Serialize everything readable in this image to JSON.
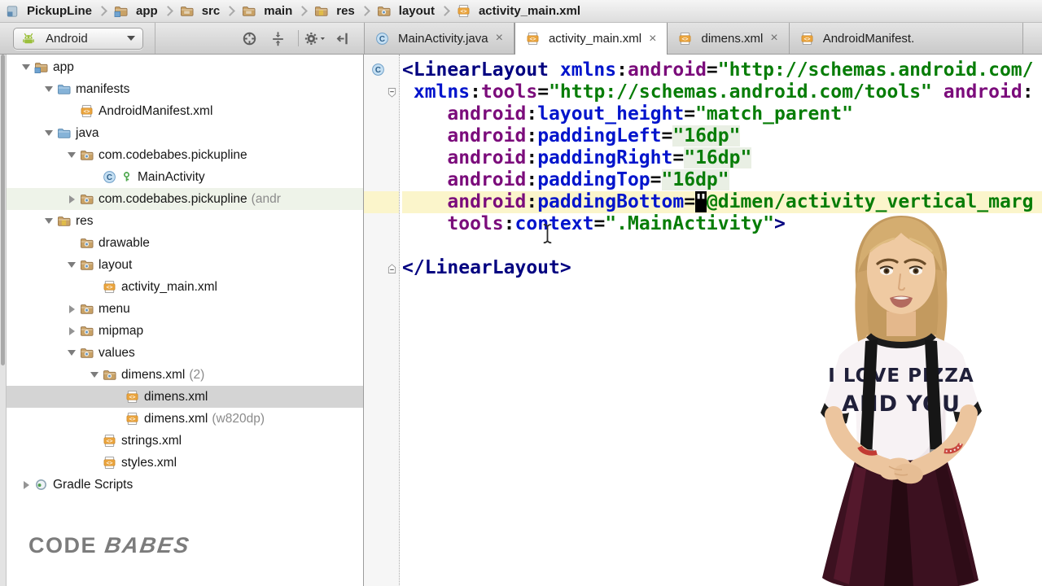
{
  "breadcrumb": {
    "items": [
      {
        "label": "PickupLine",
        "icon": "project-icon"
      },
      {
        "label": "app",
        "icon": "module-folder-icon"
      },
      {
        "label": "src",
        "icon": "folder-icon"
      },
      {
        "label": "main",
        "icon": "folder-icon"
      },
      {
        "label": "res",
        "icon": "res-folder-icon"
      },
      {
        "label": "layout",
        "icon": "package-folder-icon"
      },
      {
        "label": "activity_main.xml",
        "icon": "xml-file-icon"
      }
    ]
  },
  "project_panel": {
    "view_selector": {
      "label": "Android",
      "icon": "android-icon"
    },
    "toolbar_icons": [
      "locate-icon",
      "collapse-all-icon",
      "|",
      "settings-gear-icon",
      "hide-panel-icon"
    ],
    "tree": [
      {
        "label": "app",
        "icons": [
          "module-folder-icon"
        ],
        "indent": 0,
        "arrow": "down"
      },
      {
        "label": "manifests",
        "icons": [
          "folder-blue-icon"
        ],
        "indent": 1,
        "arrow": "down"
      },
      {
        "label": "AndroidManifest.xml",
        "icons": [
          "xml-file-icon"
        ],
        "indent": 2,
        "arrow": ""
      },
      {
        "label": "java",
        "icons": [
          "folder-blue-icon"
        ],
        "indent": 1,
        "arrow": "down"
      },
      {
        "label": "com.codebabes.pickupline",
        "icons": [
          "package-folder-icon"
        ],
        "indent": 2,
        "arrow": "down"
      },
      {
        "label": "MainActivity",
        "icons": [
          "class-icon",
          "key-icon"
        ],
        "indent": 3,
        "arrow": ""
      },
      {
        "label": "com.codebabes.pickupline",
        "suffix": " (andr",
        "icons": [
          "package-folder-icon"
        ],
        "indent": 2,
        "arrow": "right",
        "hover": true
      },
      {
        "label": "res",
        "icons": [
          "res-folder-icon"
        ],
        "indent": 1,
        "arrow": "down"
      },
      {
        "label": "drawable",
        "icons": [
          "package-folder-icon"
        ],
        "indent": 2,
        "arrow": ""
      },
      {
        "label": "layout",
        "icons": [
          "package-folder-icon"
        ],
        "indent": 2,
        "arrow": "down"
      },
      {
        "label": "activity_main.xml",
        "icons": [
          "xml-file-icon"
        ],
        "indent": 3,
        "arrow": ""
      },
      {
        "label": "menu",
        "icons": [
          "package-folder-icon"
        ],
        "indent": 2,
        "arrow": "right"
      },
      {
        "label": "mipmap",
        "icons": [
          "package-folder-icon"
        ],
        "indent": 2,
        "arrow": "right"
      },
      {
        "label": "values",
        "icons": [
          "package-folder-icon"
        ],
        "indent": 2,
        "arrow": "down"
      },
      {
        "label": "dimens.xml",
        "suffix": " (2)",
        "icons": [
          "package-folder-icon"
        ],
        "indent": 3,
        "arrow": "down"
      },
      {
        "label": "dimens.xml",
        "icons": [
          "xml-file-icon"
        ],
        "indent": 4,
        "arrow": "",
        "selected": true
      },
      {
        "label": "dimens.xml",
        "suffix": " (w820dp)",
        "icons": [
          "xml-file-icon"
        ],
        "indent": 4,
        "arrow": ""
      },
      {
        "label": "strings.xml",
        "icons": [
          "xml-file-icon"
        ],
        "indent": 3,
        "arrow": ""
      },
      {
        "label": "styles.xml",
        "icons": [
          "xml-file-icon"
        ],
        "indent": 3,
        "arrow": ""
      },
      {
        "label": "Gradle Scripts",
        "icons": [
          "gradle-icon"
        ],
        "indent": 0,
        "arrow": "right"
      }
    ]
  },
  "tabs": {
    "items": [
      {
        "label": "MainActivity.java",
        "icon": "class-icon",
        "close": true,
        "active": false
      },
      {
        "label": "activity_main.xml",
        "icon": "xml-file-icon",
        "close": true,
        "active": true
      },
      {
        "label": "dimens.xml",
        "icon": "xml-file-icon",
        "close": true,
        "active": false
      },
      {
        "label": "AndroidManifest.",
        "icon": "xml-file-icon",
        "close": false,
        "active": false
      }
    ],
    "close_glyph": "×"
  },
  "editor": {
    "lines": [
      {
        "gutter": "class-icon",
        "tokens": [
          [
            "tag",
            "<LinearLayout"
          ],
          [
            "pl",
            " "
          ],
          [
            "attr",
            "xmlns"
          ],
          [
            "pl",
            ":"
          ],
          [
            "ns",
            "android"
          ],
          [
            "pl",
            "="
          ],
          [
            "val",
            "\"http://schemas.android.com/"
          ]
        ]
      },
      {
        "gutter": "fold-open-icon",
        "tokens": [
          [
            "pl",
            " "
          ],
          [
            "attr",
            "xmlns"
          ],
          [
            "pl",
            ":"
          ],
          [
            "ns",
            "tools"
          ],
          [
            "pl",
            "="
          ],
          [
            "val",
            "\"http://schemas.android.com/tools\""
          ],
          [
            "pl",
            " "
          ],
          [
            "ns",
            "android"
          ],
          [
            "pl",
            ":"
          ]
        ]
      },
      {
        "tokens": [
          [
            "pl",
            "    "
          ],
          [
            "ns",
            "android"
          ],
          [
            "pl",
            ":"
          ],
          [
            "attr",
            "layout_height"
          ],
          [
            "pl",
            "="
          ],
          [
            "val",
            "\"match_parent\""
          ]
        ]
      },
      {
        "tokens": [
          [
            "pl",
            "    "
          ],
          [
            "ns",
            "android"
          ],
          [
            "pl",
            ":"
          ],
          [
            "attr",
            "paddingLeft"
          ],
          [
            "pl",
            "="
          ],
          [
            "valh",
            "\"16dp\""
          ]
        ]
      },
      {
        "tokens": [
          [
            "pl",
            "    "
          ],
          [
            "ns",
            "android"
          ],
          [
            "pl",
            ":"
          ],
          [
            "attr",
            "paddingRight"
          ],
          [
            "pl",
            "="
          ],
          [
            "valh",
            "\"16dp\""
          ]
        ]
      },
      {
        "tokens": [
          [
            "pl",
            "    "
          ],
          [
            "ns",
            "android"
          ],
          [
            "pl",
            ":"
          ],
          [
            "attr",
            "paddingTop"
          ],
          [
            "pl",
            "="
          ],
          [
            "valh",
            "\"16dp\""
          ]
        ]
      },
      {
        "highlight": true,
        "tokens": [
          [
            "pl",
            "    "
          ],
          [
            "ns",
            "android"
          ],
          [
            "pl",
            ":"
          ],
          [
            "attr",
            "paddingBottom"
          ],
          [
            "pl",
            "="
          ],
          [
            "cur",
            "\""
          ],
          [
            "val",
            "@dimen/activity_vertical_marg"
          ]
        ]
      },
      {
        "tokens": [
          [
            "pl",
            "    "
          ],
          [
            "ns",
            "tools"
          ],
          [
            "pl",
            ":"
          ],
          [
            "attr",
            "context"
          ],
          [
            "pl",
            "="
          ],
          [
            "val",
            "\".MainActivity\""
          ],
          [
            "tag",
            ">"
          ]
        ]
      },
      {
        "tokens": []
      },
      {
        "gutter": "fold-close-icon",
        "tokens": [
          [
            "tag",
            "</LinearLayout>"
          ]
        ]
      }
    ]
  },
  "video_overlay": {
    "shirt_line1": "I LOVE PIZZA",
    "shirt_line2": "AND YOU"
  },
  "watermark": {
    "part1": "CODE",
    "part2": "BABES"
  },
  "colors": {
    "current_line_highlight": "#fbf5cb",
    "selected_row": "#d4d4d4",
    "xml_icon_orange": "#e9a33c",
    "android_green": "#9bbf3b",
    "tag_navy": "#000080",
    "attr_blue": "#0014cc",
    "namespace_purple": "#7b0c7b",
    "value_green": "#077d07"
  }
}
